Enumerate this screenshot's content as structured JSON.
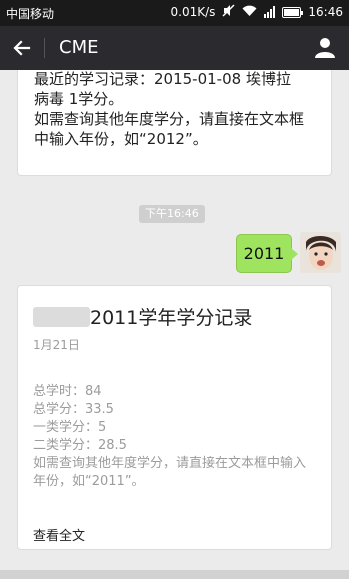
{
  "status_bar": {
    "carrier": "中国移动",
    "speed": "0.01K/s",
    "time": "16:46",
    "icons": [
      "mute-icon",
      "wifi-icon",
      "signal-icon",
      "battery-icon"
    ]
  },
  "nav": {
    "title": "CME",
    "back_icon": "arrow-left-icon",
    "profile_icon": "person-icon"
  },
  "messages": {
    "prev_card": {
      "line1": "最近的学习记录：2015-01-08 埃博拉",
      "line2": "病毒 1学分。",
      "line3": "如需查询其他年度学分，请直接在文本框",
      "line4": "中输入年份，如“2012”。"
    },
    "timestamp": "下午16:46",
    "outgoing": {
      "text": "2011"
    },
    "record_card": {
      "title": "2011学年学分记录",
      "date": "1月21日",
      "total_hours": "总学时：84",
      "total_credits": "总学分：33.5",
      "class1": "一类学分：5",
      "class2": "二类学分：28.5",
      "hint_line1": "如需查询其他年度学分，请直接在文本框中输入",
      "hint_line2": "年份，如“2011”。",
      "read_more": "查看全文"
    }
  },
  "colors": {
    "status_bar_bg": "#1a1a1a",
    "nav_bg": "#2b2b2f",
    "chat_bg": "#ebebeb",
    "outgoing_bubble": "#9fe45e",
    "muted_text": "#9c9c9c"
  }
}
